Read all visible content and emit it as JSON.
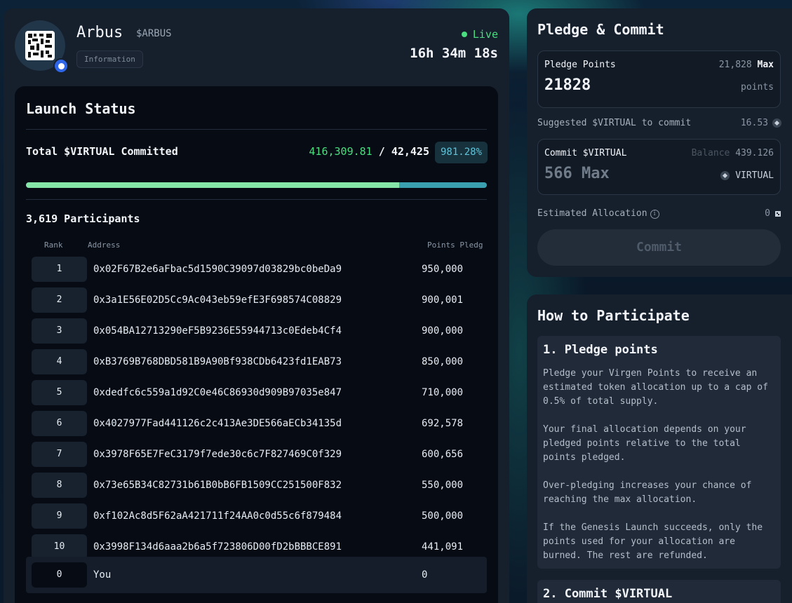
{
  "token": {
    "name": "Arbus",
    "ticker": "$ARBUS",
    "info_label": "Information",
    "status": "Live",
    "countdown": "16h 34m 18s"
  },
  "launch": {
    "title": "Launch Status",
    "total_label": "Total $VIRTUAL Committed",
    "committed": "416,309.81",
    "separator": "/",
    "target": "42,425",
    "percent": "981.28%",
    "progress_fill_fraction": 0.81,
    "participants": "3,619 Participants",
    "columns": {
      "rank": "Rank",
      "address": "Address",
      "points": "Points Pledg"
    },
    "rows": [
      {
        "rank": "1",
        "address": "0x02F67B2e6aFbac5d1590C39097d03829bc0beDa9",
        "points": "950,000"
      },
      {
        "rank": "2",
        "address": "0x3a1E56E02D5Cc9Ac043eb59efE3F698574C08829",
        "points": "900,001"
      },
      {
        "rank": "3",
        "address": "0x054BA12713290eF5B9236E55944713c0Edeb4Cf4",
        "points": "900,000"
      },
      {
        "rank": "4",
        "address": "0xB3769B768DBD581B9A90Bf938CDb6423fd1EAB73",
        "points": "850,000"
      },
      {
        "rank": "5",
        "address": "0xdedfc6c559a1d92C0e46C86930d909B97035e847",
        "points": "710,000"
      },
      {
        "rank": "6",
        "address": "0x4027977Fad441126c2c413Ae3DE566aECb34135d",
        "points": "692,578"
      },
      {
        "rank": "7",
        "address": "0x3978F65E7FeC3179f7ede30c6c7F827469C0f329",
        "points": "600,656"
      },
      {
        "rank": "8",
        "address": "0x73e65B34C82731b61B0bB6FB1509CC251500F832",
        "points": "550,000"
      },
      {
        "rank": "9",
        "address": "0xf102Ac8d5F62aA421711f24AA0c0d55c6f879484",
        "points": "500,000"
      },
      {
        "rank": "10",
        "address": "0x3998F134d6aaa2b6a5f723806D00fD2bBBBCE891",
        "points": "441,091"
      }
    ],
    "you": {
      "rank": "0",
      "address": "You",
      "points": "0"
    }
  },
  "pledge": {
    "title": "Pledge & Commit",
    "points_label": "Pledge Points",
    "points_available": "21,828",
    "max_label": "Max",
    "points_value": "21828",
    "points_unit": "points",
    "suggested_label": "Suggested $VIRTUAL to commit",
    "suggested_value": "16.53",
    "commit_label": "Commit $VIRTUAL",
    "balance_label": "Balance",
    "balance_value": "439.126",
    "commit_placeholder": "566 Max",
    "commit_unit": "VIRTUAL",
    "estimated_label": "Estimated Allocation",
    "estimated_value": "0",
    "commit_button": "Commit"
  },
  "how": {
    "title": "How to Participate",
    "step1_title": "1. Pledge points",
    "step1_paragraphs": [
      "Pledge your Virgen Points to receive an estimated token allocation up to a cap of 0.5% of total supply.",
      "Your final allocation depends on your pledged points relative to the total points pledged.",
      "Over-pledging increases your chance of reaching the max allocation.",
      "If the Genesis Launch succeeds, only the points used for your allocation are burned. The rest are refunded."
    ],
    "step2_title": "2. Commit $VIRTUAL"
  },
  "colors": {
    "accent_green": "#4ade80",
    "progress_teal": "#3aa0b0",
    "progress_fill": "#86e6a8",
    "panel": "#161f2c",
    "panel_dark": "#070b13"
  }
}
